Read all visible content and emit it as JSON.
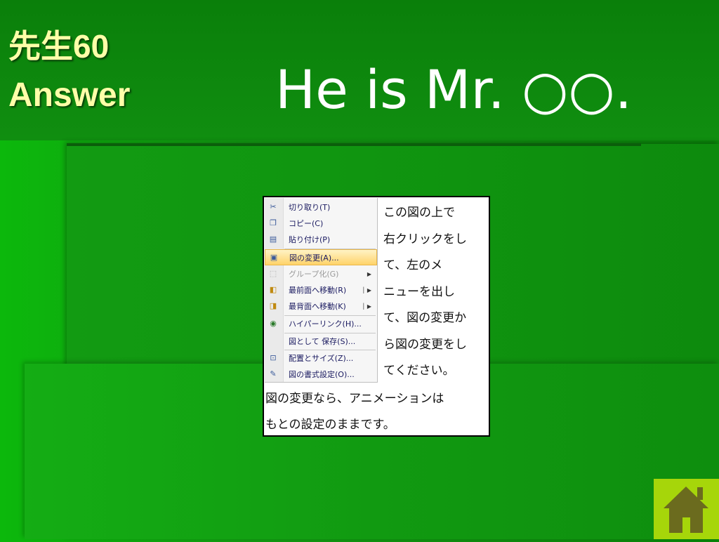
{
  "slide": {
    "title_line1": "先生60",
    "title_line2": "Answer",
    "answer": "He is Mr. ○○."
  },
  "screenshot": {
    "menu_items": [
      {
        "icon": "scissors-icon",
        "label": "切り取り(T)",
        "state": "normal"
      },
      {
        "icon": "copy-icon",
        "label": "コピー(C)",
        "state": "normal"
      },
      {
        "icon": "paste-icon",
        "label": "貼り付け(P)",
        "state": "normal"
      },
      {
        "icon": "change-picture-icon",
        "label": "図の変更(A)...",
        "state": "highlighted"
      },
      {
        "icon": "group-icon",
        "label": "グループ化(G)",
        "state": "disabled",
        "submenu": true
      },
      {
        "icon": "bring-front-icon",
        "label": "最前面へ移動(R)",
        "state": "normal",
        "submenu": true
      },
      {
        "icon": "send-back-icon",
        "label": "最背面へ移動(K)",
        "state": "normal",
        "submenu": true
      },
      {
        "icon": "hyperlink-icon",
        "label": "ハイパーリンク(H)...",
        "state": "normal"
      },
      {
        "icon": "",
        "label": "図として 保存(S)...",
        "state": "normal"
      },
      {
        "icon": "size-position-icon",
        "label": "配置とサイズ(Z)...",
        "state": "normal"
      },
      {
        "icon": "format-picture-icon",
        "label": "図の書式設定(O)...",
        "state": "normal"
      }
    ],
    "instructions": [
      "この図の上で",
      "右クリックをし",
      "て、左のメ",
      "ニューを出し",
      "て、図の変更か",
      "ら図の変更をし",
      "てください。"
    ],
    "note": [
      "図の変更なら、アニメーションは",
      "もとの設定のままです。"
    ]
  },
  "colors": {
    "title": "#ffffa8",
    "answer": "#ffffff",
    "home_button_bg": "#a6d60a",
    "home_icon": "#6b6b1e"
  }
}
